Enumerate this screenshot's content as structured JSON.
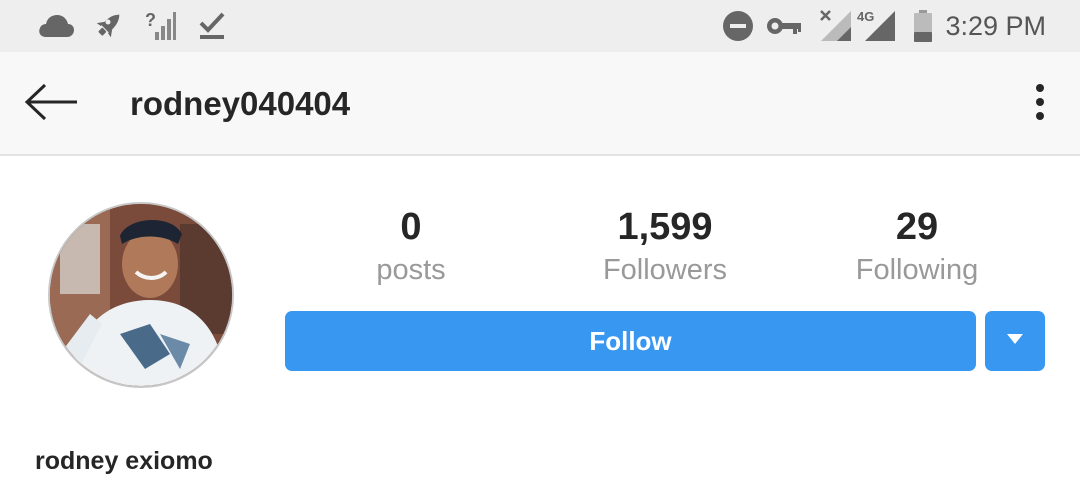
{
  "status_bar": {
    "icons": [
      "cloud-icon",
      "rocket-icon",
      "no-signal-question-icon",
      "download-done-icon",
      "do-not-disturb-icon",
      "vpn-key-icon",
      "no-sim-signal-icon",
      "4g-signal-icon",
      "battery-icon"
    ],
    "network_label": "4G",
    "time": "3:29 PM"
  },
  "app_bar": {
    "back_icon": "arrow-back-icon",
    "username": "rodney040404",
    "menu_icon": "more-vertical-icon"
  },
  "profile": {
    "avatar_alt": "profile-photo",
    "stats": [
      {
        "count": "0",
        "label": "posts"
      },
      {
        "count": "1,599",
        "label": "Followers"
      },
      {
        "count": "29",
        "label": "Following"
      }
    ],
    "follow_label": "Follow",
    "dropdown_icon": "caret-down-icon",
    "full_name": "rodney exiomo"
  },
  "colors": {
    "accent": "#3897f0",
    "status_bar_bg": "#eeeeee",
    "app_bar_bg": "#f8f8f8",
    "text_primary": "#262626",
    "text_secondary": "#999999"
  }
}
